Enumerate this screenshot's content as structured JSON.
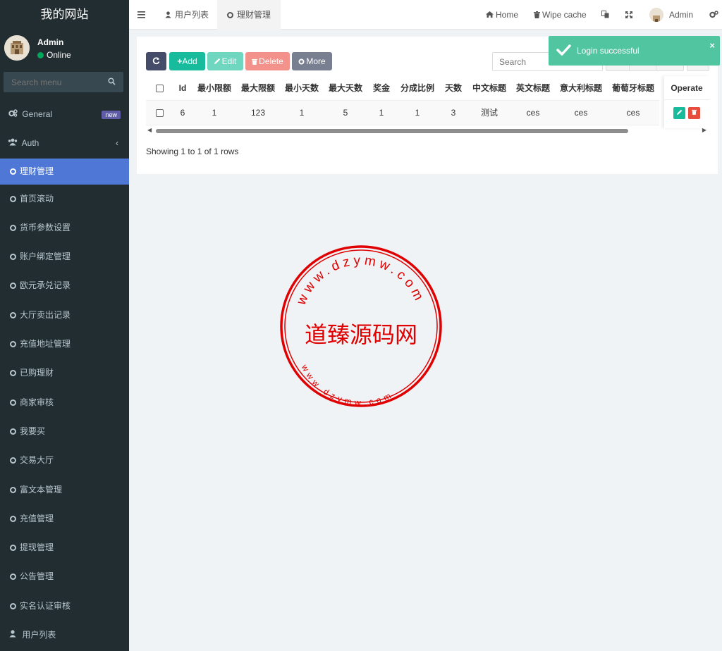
{
  "sidebar": {
    "brand": "我的网站",
    "user_name": "Admin",
    "user_status": "Online",
    "search_placeholder": "Search menu",
    "items": [
      {
        "label": "General",
        "badge": "new"
      },
      {
        "label": "Auth"
      },
      {
        "label": "理财管理",
        "active": true
      },
      {
        "label": "首页滚动"
      },
      {
        "label": "货币参数设置"
      },
      {
        "label": "账户绑定管理"
      },
      {
        "label": "欧元承兑记录"
      },
      {
        "label": "大厅卖出记录"
      },
      {
        "label": "充值地址管理"
      },
      {
        "label": "已购理财"
      },
      {
        "label": "商家审核"
      },
      {
        "label": "我要买"
      },
      {
        "label": "交易大厅"
      },
      {
        "label": "富文本管理"
      },
      {
        "label": "充值管理"
      },
      {
        "label": "提现管理"
      },
      {
        "label": "公告管理"
      },
      {
        "label": "实名认证审核"
      },
      {
        "label": "用户列表"
      }
    ]
  },
  "topbar": {
    "tabs": [
      {
        "label": "用户列表"
      },
      {
        "label": "理财管理",
        "active": true
      }
    ],
    "home_label": "Home",
    "wipe_cache_label": "Wipe cache",
    "admin_label": "Admin"
  },
  "toolbar": {
    "add_label": "Add",
    "edit_label": "Edit",
    "delete_label": "Delete",
    "more_label": "More",
    "search_placeholder": "Search"
  },
  "table": {
    "columns": [
      "Id",
      "最小限额",
      "最大限额",
      "最小天数",
      "最大天数",
      "奖金",
      "分成比例",
      "天数",
      "中文标题",
      "英文标题",
      "意大利标题",
      "葡萄牙标题"
    ],
    "operate_header": "Operate",
    "rows": [
      [
        "6",
        "1",
        "123",
        "1",
        "5",
        "1",
        "1",
        "3",
        "测试",
        "ces",
        "ces",
        "ces"
      ]
    ]
  },
  "pagination_info": "Showing 1 to 1 of 1 rows",
  "toast": {
    "message": "Login successful",
    "close": "×"
  },
  "watermark": {
    "center_text": "道臻源码网",
    "outer_text": "www.dzymw.com",
    "inner_text": "www.dzymw.com"
  },
  "colors": {
    "sidebar_bg": "#222d32",
    "active_menu": "#4f78d6",
    "add_btn": "#18bc9c",
    "edit_btn": "#6fd6c0",
    "delete_btn": "#f3918b",
    "more_btn": "#787f91",
    "refresh_btn": "#444c69",
    "toast": "#51c4a0",
    "stamp": "#e00000"
  }
}
